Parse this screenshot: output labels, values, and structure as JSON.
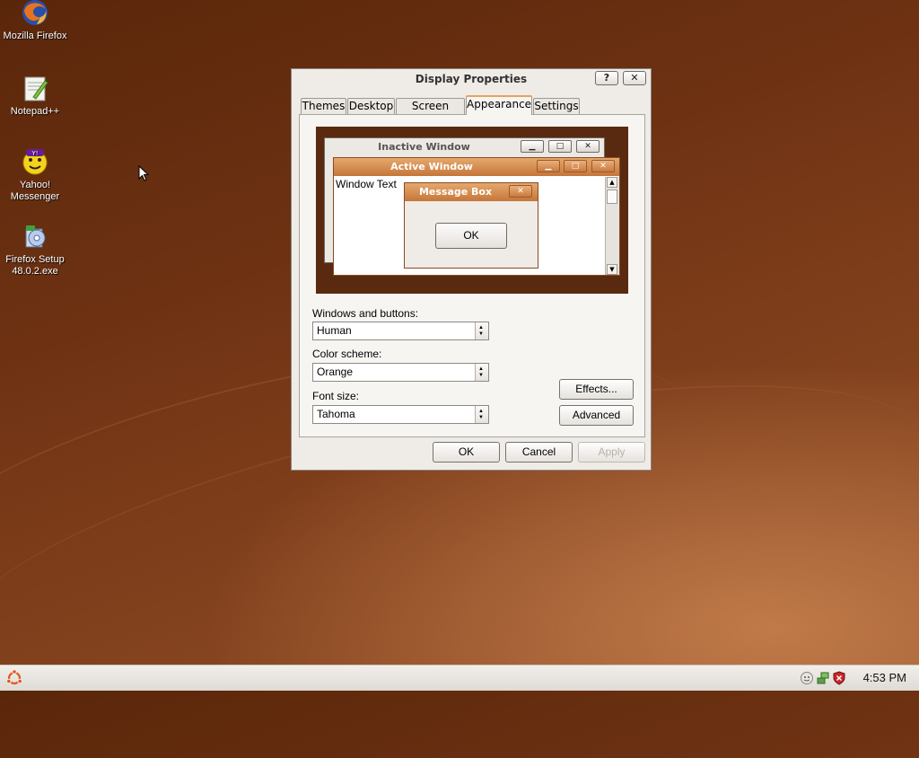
{
  "desktop": {
    "icons": [
      {
        "label": "Mozilla Firefox",
        "icon": "firefox-icon"
      },
      {
        "label": "Notepad++",
        "icon": "notepad-plus-plus-icon"
      },
      {
        "label": "Yahoo!\nMessenger",
        "icon": "yahoo-messenger-icon"
      },
      {
        "label": "Firefox Setup\n48.0.2.exe",
        "icon": "installer-icon"
      }
    ]
  },
  "dialog": {
    "title": "Display Properties",
    "help_label": "?",
    "close_label": "✕",
    "tabs": [
      {
        "label": "Themes"
      },
      {
        "label": "Desktop"
      },
      {
        "label": "Screen Saver"
      },
      {
        "label": "Appearance",
        "active": true
      },
      {
        "label": "Settings"
      }
    ],
    "preview": {
      "inactive_title": "Inactive Window",
      "active_title": "Active Window",
      "window_text": "Window Text",
      "message_title": "Message Box",
      "message_ok": "OK"
    },
    "windows_buttons": {
      "label": "Windows and buttons:",
      "value": "Human"
    },
    "color_scheme": {
      "label": "Color scheme:",
      "value": "Orange"
    },
    "font_size": {
      "label": "Font size:",
      "value": "Tahoma"
    },
    "effects_label": "Effects...",
    "advanced_label": "Advanced",
    "ok_label": "OK",
    "cancel_label": "Cancel",
    "apply_label": "Apply"
  },
  "taskbar": {
    "clock": "4:53 PM",
    "tray_icons": [
      "chat-icon",
      "network-icon",
      "security-shield-icon"
    ]
  },
  "colors": {
    "accent": "#e8a35c",
    "active_title": "#c6763a"
  }
}
